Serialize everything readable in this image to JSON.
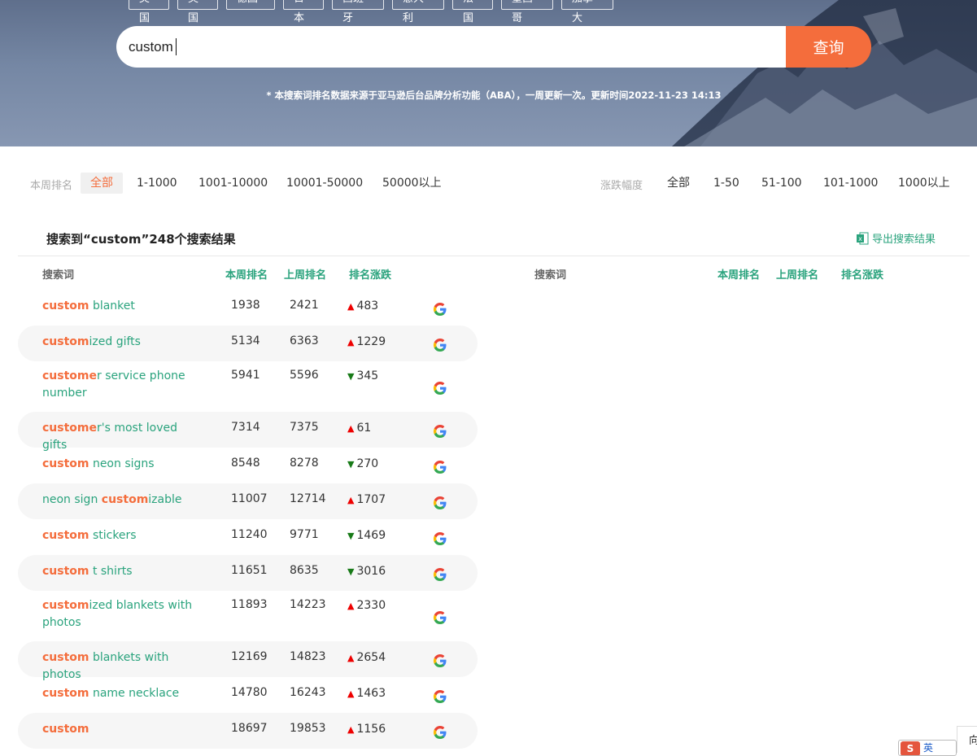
{
  "countries": [
    "美国",
    "英国",
    "德国",
    "日本",
    "西班牙",
    "意大利",
    "法国",
    "墨西哥",
    "加拿大"
  ],
  "search": {
    "value": "custom",
    "button_label": "查询"
  },
  "notice": "* 本搜索词排名数据来源于亚马逊后台品牌分析功能（ABA），一周更新一次。更新时间2022-11-23 14:13",
  "filters": {
    "rank_label": "本周排名",
    "rank_options": [
      "全部",
      "1-1000",
      "1001-10000",
      "10001-50000",
      "50000以上"
    ],
    "change_label": "涨跌幅度",
    "change_options": [
      "全部",
      "1-50",
      "51-100",
      "101-1000",
      "1000以上"
    ]
  },
  "results": {
    "title": "搜索到“custom”248个搜索结果",
    "export_label": "导出搜索结果",
    "headers": {
      "keyword": "搜索词",
      "this_week": "本周排名",
      "last_week": "上周排名",
      "change": "排名涨跌"
    },
    "rows": [
      {
        "pre": "",
        "hl": "custom",
        "post": " blanket",
        "this_week": "1938",
        "last_week": "2421",
        "direction": "up",
        "change": "483"
      },
      {
        "pre": "",
        "hl": "custom",
        "post": "ized gifts",
        "this_week": "5134",
        "last_week": "6363",
        "direction": "up",
        "change": "1229"
      },
      {
        "pre": "",
        "hl": "custome",
        "post": "r service phone number",
        "this_week": "5941",
        "last_week": "5596",
        "direction": "down",
        "change": "345"
      },
      {
        "pre": "",
        "hl": "custome",
        "post": "r's most loved gifts",
        "this_week": "7314",
        "last_week": "7375",
        "direction": "up",
        "change": "61"
      },
      {
        "pre": "",
        "hl": "custom",
        "post": " neon signs",
        "this_week": "8548",
        "last_week": "8278",
        "direction": "down",
        "change": "270"
      },
      {
        "pre": "neon sign ",
        "hl": "custom",
        "post": "izable",
        "this_week": "11007",
        "last_week": "12714",
        "direction": "up",
        "change": "1707"
      },
      {
        "pre": "",
        "hl": "custom",
        "post": " stickers",
        "this_week": "11240",
        "last_week": "9771",
        "direction": "down",
        "change": "1469"
      },
      {
        "pre": "",
        "hl": "custom",
        "post": " t shirts",
        "this_week": "11651",
        "last_week": "8635",
        "direction": "down",
        "change": "3016"
      },
      {
        "pre": "",
        "hl": "custom",
        "post": "ized blankets with photos",
        "this_week": "11893",
        "last_week": "14223",
        "direction": "up",
        "change": "2330"
      },
      {
        "pre": "",
        "hl": "custom",
        "post": " blankets with photos",
        "this_week": "12169",
        "last_week": "14823",
        "direction": "up",
        "change": "2654"
      },
      {
        "pre": "",
        "hl": "custom",
        "post": " name necklace",
        "this_week": "14780",
        "last_week": "16243",
        "direction": "up",
        "change": "1463"
      },
      {
        "pre": "",
        "hl": "custom",
        "post": "",
        "this_week": "18697",
        "last_week": "19853",
        "direction": "up",
        "change": "1156"
      }
    ]
  },
  "corner": {
    "logo_text": "英",
    "side_text": "向"
  },
  "colors": {
    "accent": "#f46d3c",
    "green": "#2aa37d",
    "up": "#e00000",
    "down": "#187a18"
  }
}
